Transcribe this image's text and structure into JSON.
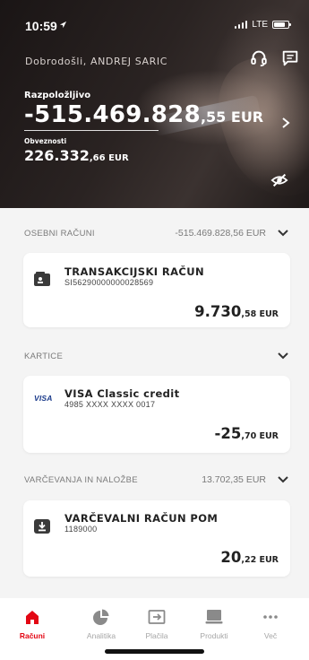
{
  "status_bar": {
    "time": "10:59",
    "network": "LTE"
  },
  "header": {
    "welcome": "Dobrodošli, ANDREJ SARIC",
    "available_label": "Razpoložljivo",
    "available_int": "-515.469.828",
    "available_dec": ",55",
    "available_currency": " EUR",
    "obligations_label": "Obveznosti",
    "obligations_int": "226.332",
    "obligations_dec": ",66 EUR",
    "icons": [
      "headset-icon",
      "message-icon",
      "chevron-right-icon",
      "eye-slash-icon"
    ]
  },
  "sections": [
    {
      "title": "OSEBNI RAČUNI",
      "total": "-515.469.828,56 EUR",
      "card": {
        "icon": "wallet-icon",
        "title": "TRANSAKCIJSKI RAČUN",
        "subtitle": "SI56290000000028569",
        "amount_int": "9.730",
        "amount_dec": ",58 EUR"
      }
    },
    {
      "title": "KARTICE",
      "total": "",
      "card": {
        "icon": "visa-logo",
        "logo_text": "VISA",
        "title": "VISA Classic credit",
        "subtitle": "4985 XXXX XXXX 0017",
        "amount_int": "-25",
        "amount_dec": ",70 EUR"
      }
    },
    {
      "title": "VARČEVANJA IN NALOŽBE",
      "total": "13.702,35 EUR",
      "card": {
        "icon": "savings-icon",
        "title": "VARČEVALNI RAČUN POM",
        "subtitle": "1189000",
        "amount_int": "20",
        "amount_dec": ",22 EUR"
      }
    }
  ],
  "tabs": [
    {
      "label": "Računi",
      "icon": "home-icon",
      "active": true
    },
    {
      "label": "Analitika",
      "icon": "pie-chart-icon",
      "active": false
    },
    {
      "label": "Plačila",
      "icon": "payments-icon",
      "active": false
    },
    {
      "label": "Produkti",
      "icon": "products-icon",
      "active": false
    },
    {
      "label": "Več",
      "icon": "more-icon",
      "active": false
    }
  ],
  "colors": {
    "accent": "#e30613",
    "background": "#f4f4f4",
    "card": "#ffffff",
    "muted_text": "#7a7a7a"
  }
}
